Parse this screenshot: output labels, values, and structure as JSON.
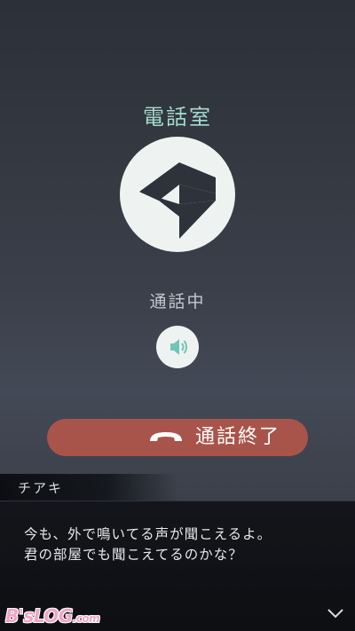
{
  "call": {
    "room_name": "電話室",
    "status": "通話中",
    "end_call_label": "通話終了"
  },
  "dialogue": {
    "speaker": "チアキ",
    "lines": [
      "今も、外で鳴いてる声が聞こえるよ。",
      "君の部屋でも聞こえてるのかな？"
    ]
  },
  "icons": {
    "caller": "caller-logo-icon",
    "speaker": "speaker-icon",
    "end_call": "phone-hangup-icon",
    "advance": "chevron-down-icon"
  },
  "watermark": {
    "main": "B'sLOG",
    "suffix": ".com"
  },
  "colors": {
    "accent_title": "#a3dccd",
    "end_call": "#a9544a",
    "icon_fill": "#2e323b",
    "speaker_icon": "#72c6b7"
  }
}
